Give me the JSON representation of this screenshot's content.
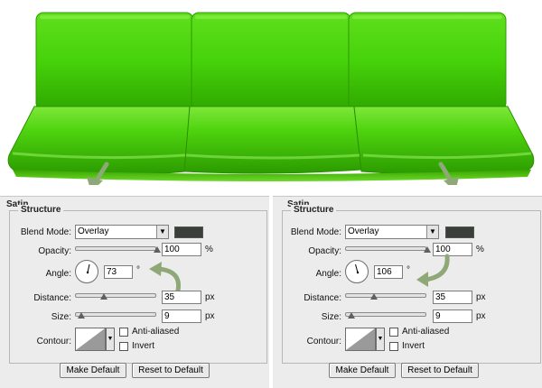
{
  "colors": {
    "sofa_green": "#3dcc00",
    "arrow_green": "#8ea977",
    "shadow_color": "#3a3f3a"
  },
  "panels": [
    {
      "title": "Satin",
      "structure_label": "Structure",
      "blend_mode_label": "Blend Mode:",
      "blend_mode_value": "Overlay",
      "opacity_label": "Opacity:",
      "opacity_value": "100",
      "opacity_unit": "%",
      "angle_label": "Angle:",
      "angle_value": "73",
      "angle_unit": "°",
      "distance_label": "Distance:",
      "distance_value": "35",
      "distance_unit": "px",
      "size_label": "Size:",
      "size_value": "9",
      "size_unit": "px",
      "contour_label": "Contour:",
      "anti_aliased_label": "Anti-aliased",
      "invert_label": "Invert",
      "make_default_label": "Make Default",
      "reset_default_label": "Reset to Default"
    },
    {
      "title": "Satin",
      "structure_label": "Structure",
      "blend_mode_label": "Blend Mode:",
      "blend_mode_value": "Overlay",
      "opacity_label": "Opacity:",
      "opacity_value": "100",
      "opacity_unit": "%",
      "angle_label": "Angle:",
      "angle_value": "106",
      "angle_unit": "°",
      "distance_label": "Distance:",
      "distance_value": "35",
      "distance_unit": "px",
      "size_label": "Size:",
      "size_value": "9",
      "size_unit": "px",
      "contour_label": "Contour:",
      "anti_aliased_label": "Anti-aliased",
      "invert_label": "Invert",
      "make_default_label": "Make Default",
      "reset_default_label": "Reset to Default"
    }
  ]
}
